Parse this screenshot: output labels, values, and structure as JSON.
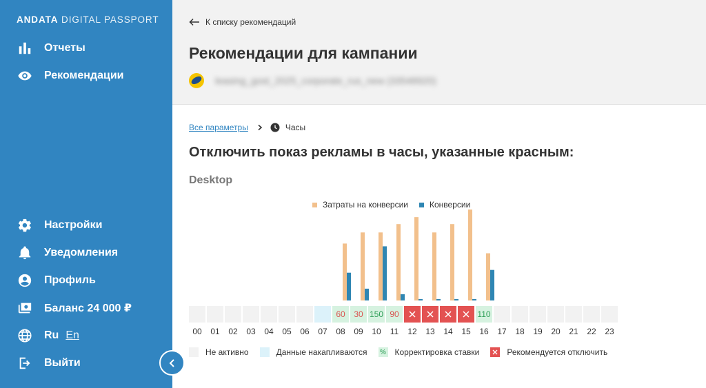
{
  "sidebar": {
    "logo_bold": "ANDATA",
    "logo_rest": "DIGITAL PASSPORT",
    "items": {
      "reports": "Отчеты",
      "recommendations": "Рекомендации",
      "settings": "Настройки",
      "notifications": "Уведомления",
      "profile": "Профиль",
      "balance": "Баланс 24 000 ₽",
      "lang_ru": "Ru",
      "lang_en": "En",
      "logout": "Выйти"
    }
  },
  "header": {
    "back_label": "К списку рекомендаций",
    "title": "Рекомендации для кампании",
    "campaign_name": "leasing_gost_2025_corporate_rus_new (33548920)"
  },
  "breadcrumb": {
    "all_params": "Все параметры",
    "current": "Часы"
  },
  "subtitle": "Отключить показ рекламы в часы, указанные красным:",
  "device_label": "Desktop",
  "legend": {
    "spend_label": "Затраты на конверсии",
    "conv_label": "Конверсии"
  },
  "colors": {
    "accent": "#3185c1",
    "spend": "#f2c08c",
    "conversions": "#2f86b3",
    "disable": "#e35252",
    "adjust_text": "#2e9e57",
    "raise_text": "#d9534f"
  },
  "chart_data": {
    "type": "bar",
    "categories": [
      "00",
      "01",
      "02",
      "03",
      "04",
      "05",
      "06",
      "07",
      "08",
      "09",
      "10",
      "11",
      "12",
      "13",
      "14",
      "15",
      "16",
      "17",
      "18",
      "19",
      "20",
      "21",
      "22",
      "23"
    ],
    "series": [
      {
        "name": "Затраты на конверсии",
        "values": [
          0,
          0,
          0,
          0,
          0,
          0,
          0,
          0,
          82,
          98,
          98,
          110,
          120,
          98,
          110,
          131,
          68,
          0,
          0,
          0,
          0,
          0,
          0,
          0
        ]
      },
      {
        "name": "Конверсии",
        "values": [
          0,
          0,
          0,
          0,
          0,
          0,
          0,
          0,
          40,
          17,
          78,
          9,
          2,
          2,
          2,
          2,
          44,
          0,
          0,
          0,
          0,
          0,
          0,
          0
        ]
      }
    ],
    "ylim": [
      0,
      135
    ]
  },
  "hour_cells": [
    {
      "hour": "00",
      "status": "inactive",
      "label": ""
    },
    {
      "hour": "01",
      "status": "inactive",
      "label": ""
    },
    {
      "hour": "02",
      "status": "inactive",
      "label": ""
    },
    {
      "hour": "03",
      "status": "inactive",
      "label": ""
    },
    {
      "hour": "04",
      "status": "inactive",
      "label": ""
    },
    {
      "hour": "05",
      "status": "inactive",
      "label": ""
    },
    {
      "hour": "06",
      "status": "inactive",
      "label": ""
    },
    {
      "hour": "07",
      "status": "accumulating",
      "label": ""
    },
    {
      "hour": "08",
      "status": "adjust-down",
      "label": "60"
    },
    {
      "hour": "09",
      "status": "adjust-down",
      "label": "30"
    },
    {
      "hour": "10",
      "status": "adjust-up",
      "label": "150"
    },
    {
      "hour": "11",
      "status": "adjust-down",
      "label": "90"
    },
    {
      "hour": "12",
      "status": "disable",
      "label": ""
    },
    {
      "hour": "13",
      "status": "disable",
      "label": ""
    },
    {
      "hour": "14",
      "status": "disable",
      "label": ""
    },
    {
      "hour": "15",
      "status": "disable",
      "label": ""
    },
    {
      "hour": "16",
      "status": "adjust-up",
      "label": "110"
    },
    {
      "hour": "17",
      "status": "inactive",
      "label": ""
    },
    {
      "hour": "18",
      "status": "inactive",
      "label": ""
    },
    {
      "hour": "19",
      "status": "inactive",
      "label": ""
    },
    {
      "hour": "20",
      "status": "inactive",
      "label": ""
    },
    {
      "hour": "21",
      "status": "inactive",
      "label": ""
    },
    {
      "hour": "22",
      "status": "inactive",
      "label": ""
    },
    {
      "hour": "23",
      "status": "inactive",
      "label": ""
    }
  ],
  "status_legend": {
    "inactive": "Не активно",
    "accumulating": "Данные накапливаются",
    "adjust_symbol": "%",
    "adjust": "Корректировка ставки",
    "disable": "Рекомендуется отключить"
  }
}
